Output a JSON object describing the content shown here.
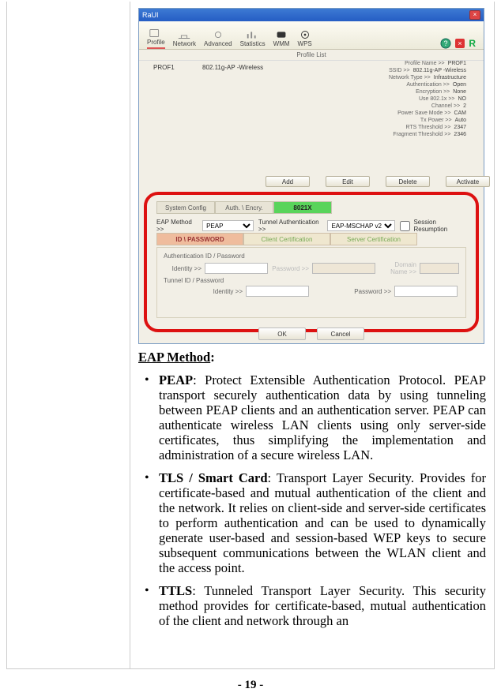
{
  "app": {
    "title": "RaUI"
  },
  "toolbar": [
    "Profile",
    "Network",
    "Advanced",
    "Statistics",
    "WMM",
    "WPS"
  ],
  "profile_list_label": "Profile List",
  "profile_row": {
    "name": "PROF1",
    "ssid": "802.11g-AP -Wireless"
  },
  "details": [
    {
      "k": "Profile Name >>",
      "v": "PROF1"
    },
    {
      "k": "SSID >>",
      "v": "802.11g-AP -Wireless"
    },
    {
      "k": "Network Type >>",
      "v": "Infrastructure"
    },
    {
      "k": "Authentication >>",
      "v": "Open"
    },
    {
      "k": "Encryption >>",
      "v": "None"
    },
    {
      "k": "Use 802.1x >>",
      "v": "NO"
    },
    {
      "k": "Channel >>",
      "v": "2"
    },
    {
      "k": "Power Save Mode >>",
      "v": "CAM"
    },
    {
      "k": "Tx Power >>",
      "v": "Auto"
    },
    {
      "k": "RTS Threshold >>",
      "v": "2347"
    },
    {
      "k": "Fragment Threshold >>",
      "v": "2346"
    }
  ],
  "pbtns": [
    "Add",
    "Edit",
    "Delete",
    "Activate"
  ],
  "subtabs": [
    "System Config",
    "Auth. \\ Encry.",
    "8021X"
  ],
  "methodsrow": {
    "eap_label": "EAP Method >>",
    "eap_value": "PEAP",
    "tunnel_label": "Tunnel Authentication >>",
    "tunnel_value": "EAP-MSCHAP v2",
    "session": "Session Resumption"
  },
  "certtabs": [
    "ID \\ PASSWORD",
    "Client Certification",
    "Server Certification"
  ],
  "form": {
    "grp1": "Authentication ID / Password",
    "grp2": "Tunnel ID / Password",
    "identity": "Identity >>",
    "password": "Password >>",
    "domain": "Domain Name >>"
  },
  "okcancel": [
    "OK",
    "Cancel"
  ],
  "doc": {
    "heading": "EAP Method",
    "items": [
      {
        "b": "PEAP",
        "t": ": Protect Extensible Authentication Protocol. PEAP transport securely authentication data by using tunneling between PEAP clients and an authentication server. PEAP can authenticate wireless LAN clients using only server-side certificates, thus simplifying the implementation and administration of a secure wireless LAN."
      },
      {
        "b": "TLS / Smart Card",
        "t": ": Transport Layer Security. Provides for certificate-based and mutual authentication of the client and the network. It relies on client-side and server-side certificates to perform authentication and can be used to dynamically generate user-based and session-based WEP keys to secure subsequent communications between the WLAN client and the access point."
      },
      {
        "b": "TTLS",
        "t": ": Tunneled Transport Layer Security. This security method provides for certificate-based, mutual authentication of the client and network through an"
      }
    ]
  },
  "footer": "- 19 -"
}
